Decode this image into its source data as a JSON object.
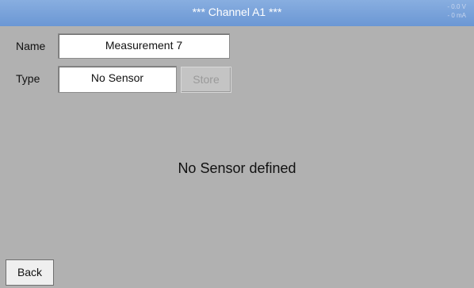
{
  "header": {
    "title": "*** Channel A1 ***",
    "status_voltage": "- 0.0 V",
    "status_current": "- 0 mA"
  },
  "form": {
    "name_label": "Name",
    "name_value": "Measurement 7",
    "type_label": "Type",
    "type_value": "No Sensor",
    "store_label": "Store"
  },
  "main": {
    "message": "No Sensor defined"
  },
  "footer": {
    "back_label": "Back"
  },
  "colors": {
    "titlebar": "#6b97d4",
    "background": "#b1b1b1"
  }
}
